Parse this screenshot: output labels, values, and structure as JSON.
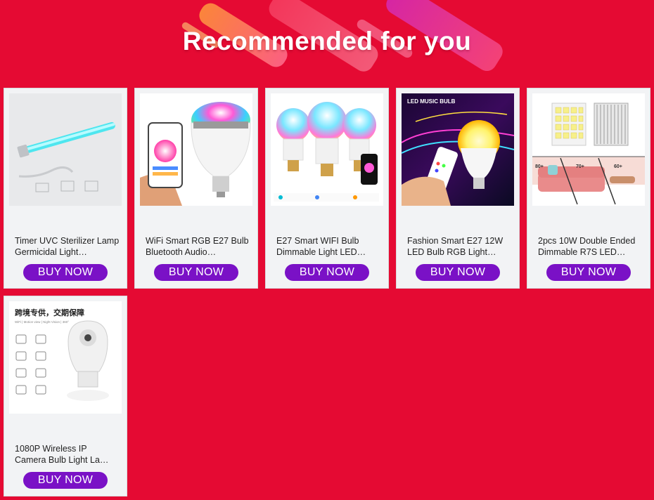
{
  "page": {
    "title": "Recommended for you",
    "accent_bg": "#e50a33",
    "button_color": "#7a11c6"
  },
  "products": [
    {
      "name": "Timer UVC Sterilizer Lamp Germicidal Light…",
      "button": "BUY NOW",
      "image": "uv-tube-lamp-icon"
    },
    {
      "name": "WiFi Smart RGB E27 Bulb Bluetooth Audio…",
      "button": "BUY NOW",
      "image": "speaker-bulb-icon"
    },
    {
      "name": "E27 Smart WIFI Bulb Dimmable Light LED…",
      "button": "BUY NOW",
      "image": "three-bulbs-icon"
    },
    {
      "name": "Fashion Smart E27 12W LED Bulb RGB Light…",
      "button": "BUY NOW",
      "image": "music-bulb-icon"
    },
    {
      "name": "2pcs 10W Double Ended Dimmable R7S LED…",
      "button": "BUY NOW",
      "image": "r7s-led-icon"
    },
    {
      "name": "1080P Wireless IP Camera Bulb Light La…",
      "button": "BUY NOW",
      "image": "camera-bulb-icon"
    }
  ],
  "image_text": {
    "music_badge": "LED MUSIC BULB",
    "camera_heading": "跨境专供，交期保障",
    "camera_sub": "WiFi | Motion view | Night Vision | 360°",
    "sofa_labels": [
      "80+",
      "70+",
      "60+"
    ]
  }
}
